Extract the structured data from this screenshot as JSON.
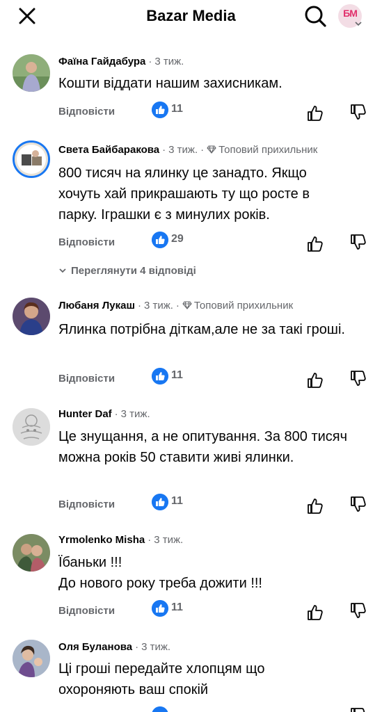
{
  "header": {
    "title": "Bazar Media",
    "avatar_text": "БМ"
  },
  "comments": [
    {
      "name": "Фаїна Гайдабура",
      "time": "3 тиж.",
      "badge": "",
      "text": "Кошти  віддати нашим захисникам.",
      "reply_label": "Відповісти",
      "likes": "11"
    },
    {
      "name": "Света Байбаракова",
      "time": "3 тиж.",
      "badge": "Топовий прихильник",
      "text": "800 тисяч на ялинку це занадто. Якщо хочуть хай прикрашають ту що росте в парку. Іграшки є з минулих років.",
      "reply_label": "Відповісти",
      "likes": "29",
      "view_replies": "Переглянути 4 відповіді"
    },
    {
      "name": "Любаня Лукаш",
      "time": "3 тиж.",
      "badge": "Топовий прихильник",
      "text": "Ялинка потрібна діткам,але не за такі гроші.",
      "reply_label": "Відповісти",
      "likes": "11"
    },
    {
      "name": "Hunter Daf",
      "time": "3 тиж.",
      "badge": "",
      "text": "Це знущання, а не опитування. За 800 тисяч можна років 50 ставити живі ялинки.",
      "reply_label": "Відповісти",
      "likes": "11"
    },
    {
      "name": "Yrmolenko Misha",
      "time": "3 тиж.",
      "badge": "",
      "text_lines": [
        "Їбаньки !!!",
        "До нового року треба дожити !!!"
      ],
      "reply_label": "Відповісти",
      "likes": "11"
    },
    {
      "name": "Оля Буланова",
      "time": "3 тиж.",
      "badge": "",
      "text": "Ці гроші передайте хлопцям що охороняють ваш спокій"
    }
  ],
  "colors": {
    "accent": "#1877f2",
    "muted": "#65676b",
    "text": "#050505"
  }
}
